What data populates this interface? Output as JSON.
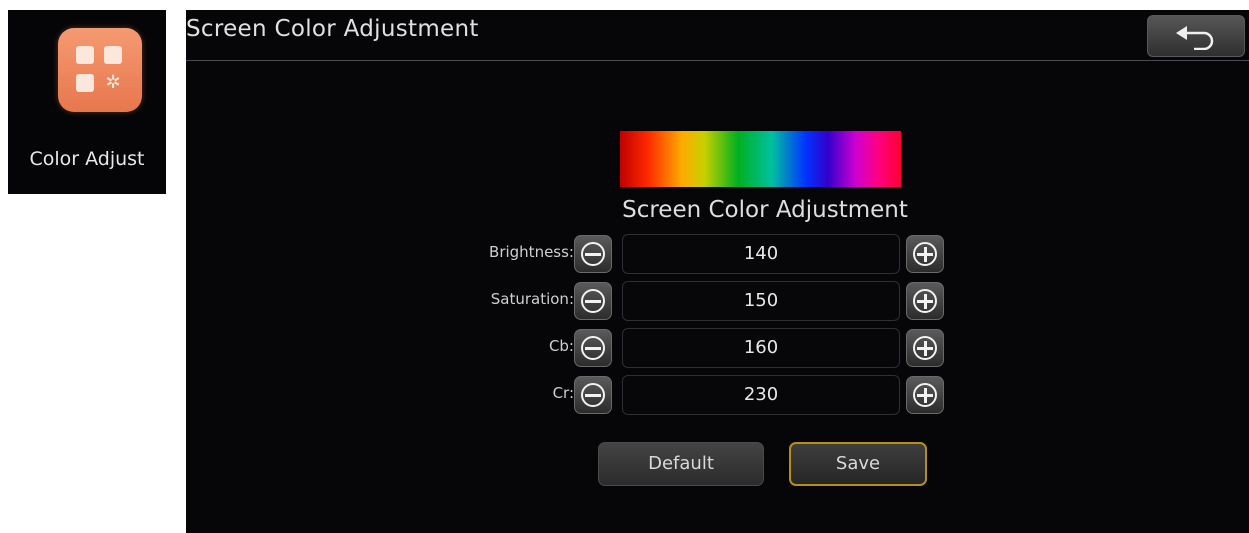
{
  "launcher": {
    "app_label": "Color Adjust",
    "icon": "grid-gear-icon",
    "icon_color": "#ee8a5f"
  },
  "header": {
    "title": "Screen Color Adjustment",
    "back_icon": "back-arrow-icon"
  },
  "panel": {
    "subtitle": "Screen Color Adjustment",
    "settings": [
      {
        "label": "Brightness:",
        "value": "140"
      },
      {
        "label": "Saturation:",
        "value": "150"
      },
      {
        "label": "Cb:",
        "value": "160"
      },
      {
        "label": "Cr:",
        "value": "230"
      }
    ],
    "buttons": {
      "default_label": "Default",
      "save_label": "Save"
    }
  },
  "colors": {
    "background": "#060609",
    "accent_border": "#b58f1e"
  }
}
